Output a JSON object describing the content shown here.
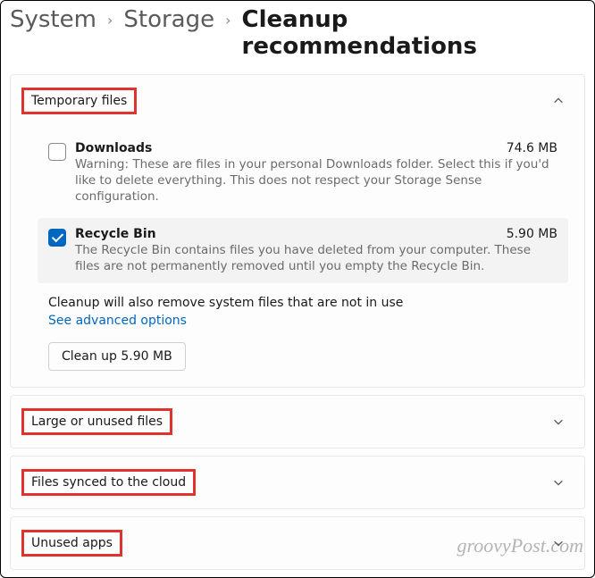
{
  "breadcrumbs": {
    "item0": "System",
    "item1": "Storage",
    "current": "Cleanup recommendations"
  },
  "sections": {
    "temp": {
      "title": "Temporary files",
      "items": [
        {
          "title": "Downloads",
          "size": "74.6 MB",
          "desc": "Warning: These are files in your personal Downloads folder. Select this if you'd like to delete everything. This does not respect your Storage Sense configuration.",
          "checked": false
        },
        {
          "title": "Recycle Bin",
          "size": "5.90 MB",
          "desc": "The Recycle Bin contains files you have deleted from your computer. These files are not permanently removed until you empty the Recycle Bin.",
          "checked": true
        }
      ],
      "note": "Cleanup will also remove system files that are not in use",
      "advanced_link": "See advanced options",
      "cleanup_button": "Clean up 5.90 MB"
    },
    "large": {
      "title": "Large or unused files"
    },
    "cloud": {
      "title": "Files synced to the cloud"
    },
    "unused": {
      "title": "Unused apps"
    }
  },
  "watermark": "groovyPost.com"
}
